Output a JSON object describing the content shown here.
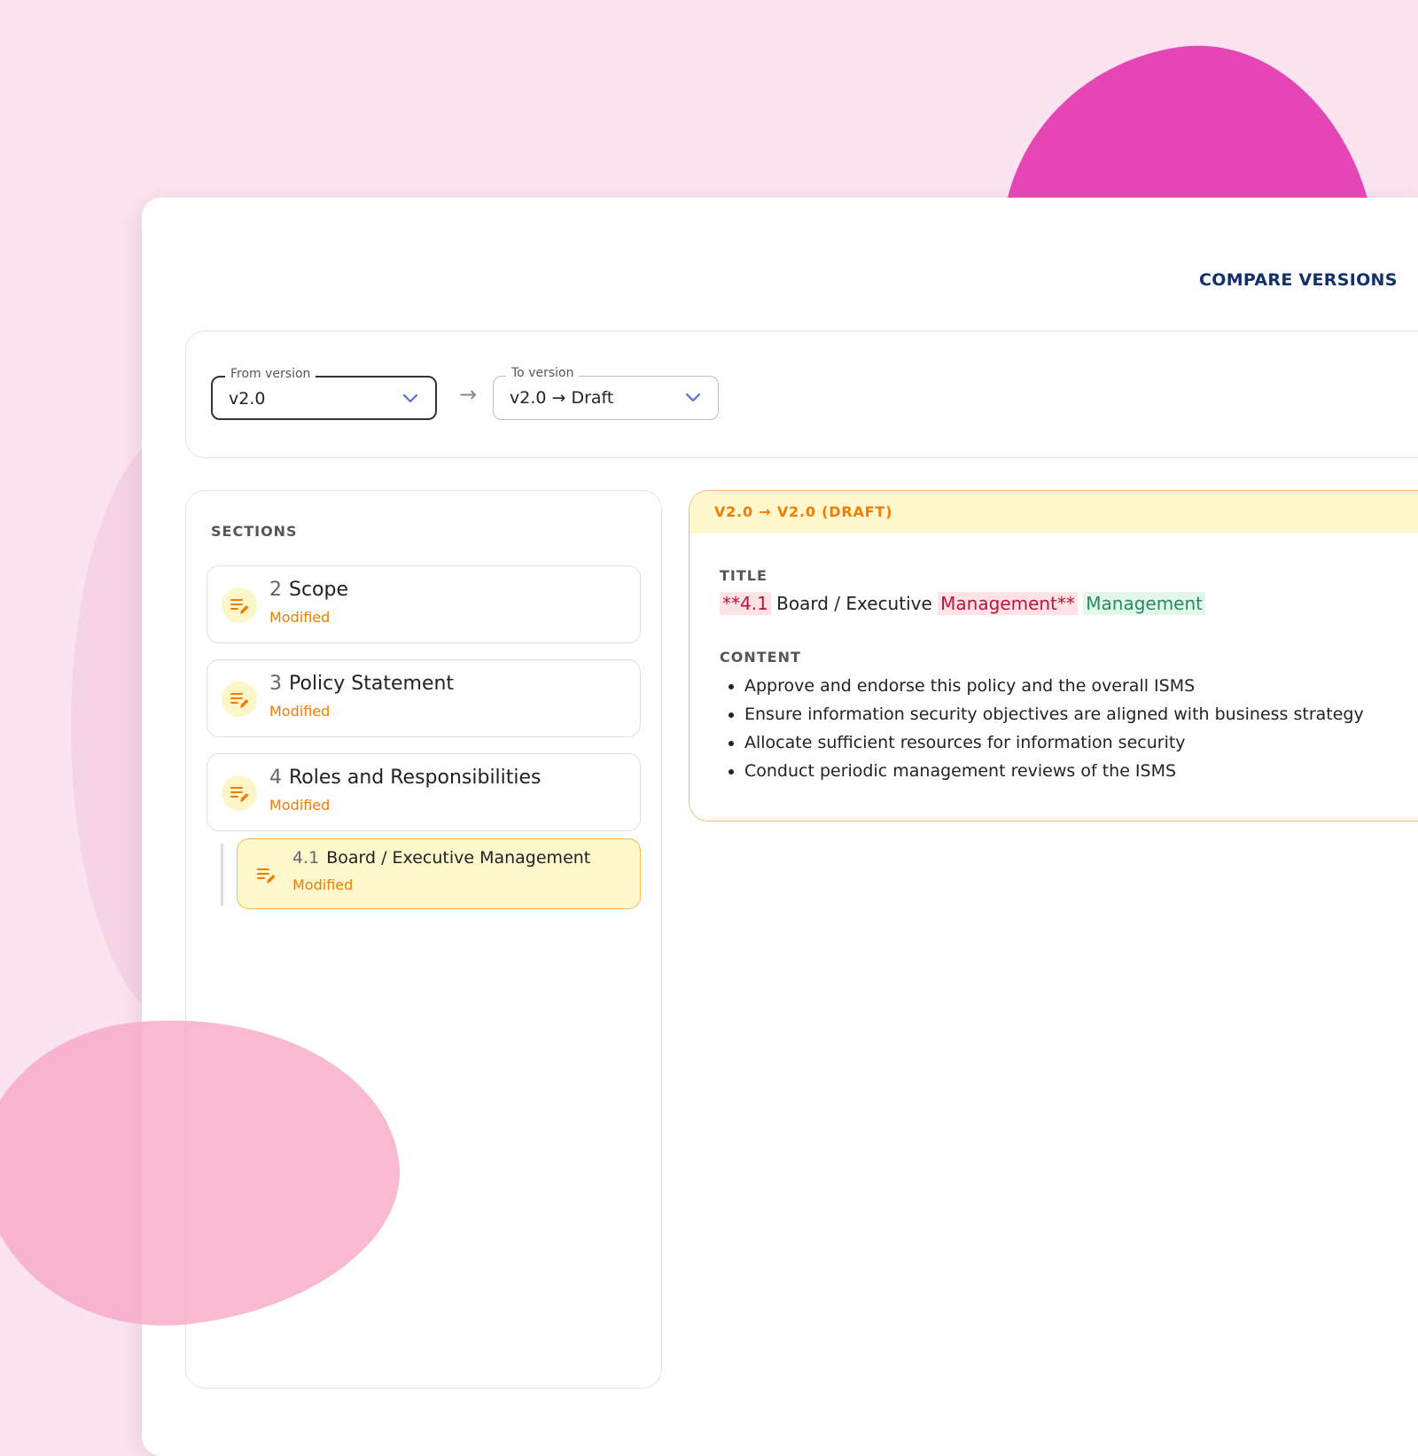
{
  "header": {
    "title": "COMPARE VERSIONS"
  },
  "selector": {
    "from": {
      "label": "From version",
      "value": "v2.0"
    },
    "to": {
      "label": "To version",
      "value": "v2.0 → Draft"
    },
    "arrow": "→"
  },
  "sections": {
    "heading": "SECTIONS",
    "items": [
      {
        "number": "2",
        "title": "Scope",
        "status": "Modified"
      },
      {
        "number": "3",
        "title": "Policy Statement",
        "status": "Modified"
      },
      {
        "number": "4",
        "title": "Roles and Responsibilities",
        "status": "Modified"
      },
      {
        "number": "4.1",
        "title": "Board / Executive Management",
        "status": "Modified",
        "selected": true
      }
    ]
  },
  "diff": {
    "header": "V2.0 → V2.0 (DRAFT)",
    "title_label": "TITLE",
    "title_parts": {
      "del1": "**4.1",
      "plain": " Board / Executive ",
      "del2": "Management**",
      "ins": "Management"
    },
    "content_label": "CONTENT",
    "content_items": [
      "Approve and endorse this policy and the overall ISMS",
      "Ensure information security objectives are aligned with business strategy",
      "Allocate sufficient resources for information security",
      "Conduct periodic management reviews of the ISMS"
    ]
  },
  "colors": {
    "background": "#fbe4ef",
    "accent_navy": "#12306e",
    "modified_orange": "#f57c00",
    "deletion_red": "#c2113a",
    "insertion_green": "#2a8a5e",
    "blob_magenta": "#e545b5"
  },
  "icons": {
    "section_status": "edit-note-icon",
    "dropdown": "chevron-down-icon"
  }
}
